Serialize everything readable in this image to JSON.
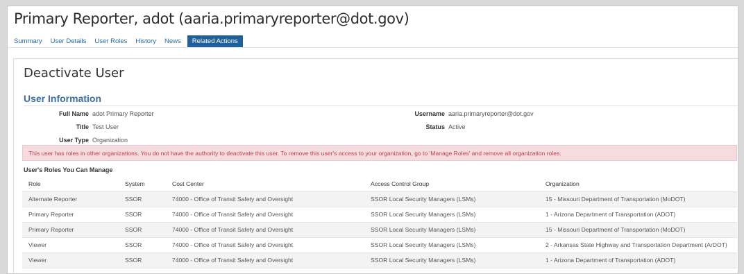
{
  "header": {
    "title": "Primary Reporter, adot (aaria.primaryreporter@dot.gov)"
  },
  "tabs": [
    {
      "label": "Summary"
    },
    {
      "label": "User Details"
    },
    {
      "label": "User Roles"
    },
    {
      "label": "History"
    },
    {
      "label": "News"
    },
    {
      "label": "Related Actions"
    }
  ],
  "main": {
    "section_title": "Deactivate User",
    "user_info": {
      "heading": "User Information",
      "full_name_label": "Full Name",
      "full_name": "adot Primary Reporter",
      "title_label": "Title",
      "title": "Test User",
      "user_type_label": "User Type",
      "user_type": "Organization",
      "username_label": "Username",
      "username": "aaria.primaryreporter@dot.gov",
      "status_label": "Status",
      "status": "Active"
    },
    "alert": "This user has roles in other organizations. You do not have the authority to deactivate this user. To remove this user's access to your organization, go to 'Manage Roles' and remove all organization roles.",
    "roles_table": {
      "caption": "User's Roles You Can Manage",
      "columns": [
        "Role",
        "System",
        "Cost Center",
        "Access Control Group",
        "Organization"
      ],
      "rows": [
        [
          "Alternate Reporter",
          "SSOR",
          "74000 - Office of Transit Safety and Oversight",
          "SSOR Local Security Managers (LSMs)",
          "15 - Missouri Department of Transportation (MoDOT)"
        ],
        [
          "Primary Reporter",
          "SSOR",
          "74000 - Office of Transit Safety and Oversight",
          "SSOR Local Security Managers (LSMs)",
          "1 - Arizona Department of Transportation (ADOT)"
        ],
        [
          "Primary Reporter",
          "SSOR",
          "74000 - Office of Transit Safety and Oversight",
          "SSOR Local Security Managers (LSMs)",
          "15 - Missouri Department of Transportation (MoDOT)"
        ],
        [
          "Viewer",
          "SSOR",
          "74000 - Office of Transit Safety and Oversight",
          "SSOR Local Security Managers (LSMs)",
          "2 - Arkansas State Highway and Transportation Department (ArDOT)"
        ],
        [
          "Viewer",
          "SSOR",
          "74000 - Office of Transit Safety and Oversight",
          "SSOR Local Security Managers (LSMs)",
          "1 - Arizona Department of Transportation (ADOT)"
        ]
      ]
    }
  },
  "colors": {
    "link": "#2a6aa8",
    "active_tab": "#1f5f9a",
    "alert_bg": "#f6dcdf",
    "alert_text": "#b4414a",
    "heading": "#3a6ea5"
  }
}
